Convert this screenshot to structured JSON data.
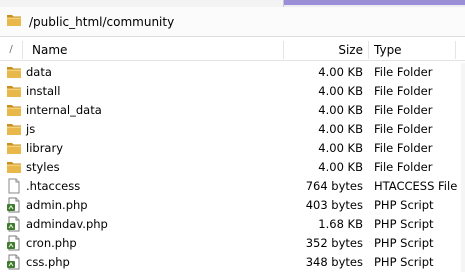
{
  "path": "/public_html/community",
  "header": {
    "sort_indicator": "/",
    "name": "Name",
    "size": "Size",
    "type": "Type"
  },
  "files": [
    {
      "name": "data",
      "size": "4.00 KB",
      "type": "File Folder",
      "icon": "folder-icon"
    },
    {
      "name": "install",
      "size": "4.00 KB",
      "type": "File Folder",
      "icon": "folder-icon"
    },
    {
      "name": "internal_data",
      "size": "4.00 KB",
      "type": "File Folder",
      "icon": "folder-icon"
    },
    {
      "name": "js",
      "size": "4.00 KB",
      "type": "File Folder",
      "icon": "folder-icon"
    },
    {
      "name": "library",
      "size": "4.00 KB",
      "type": "File Folder",
      "icon": "folder-icon"
    },
    {
      "name": "styles",
      "size": "4.00 KB",
      "type": "File Folder",
      "icon": "folder-icon"
    },
    {
      "name": ".htaccess",
      "size": "764 bytes",
      "type": "HTACCESS File",
      "icon": "blank-file-icon"
    },
    {
      "name": "admin.php",
      "size": "403 bytes",
      "type": "PHP Script",
      "icon": "php-file-icon"
    },
    {
      "name": "admindav.php",
      "size": "1.68 KB",
      "type": "PHP Script",
      "icon": "php-file-icon"
    },
    {
      "name": "cron.php",
      "size": "352 bytes",
      "type": "PHP Script",
      "icon": "php-file-icon"
    },
    {
      "name": "css.php",
      "size": "348 bytes",
      "type": "PHP Script",
      "icon": "php-file-icon"
    }
  ],
  "colors": {
    "folder": "#e8b84a",
    "folder_dark": "#c98f1f",
    "accent": "#9a8fd6"
  }
}
